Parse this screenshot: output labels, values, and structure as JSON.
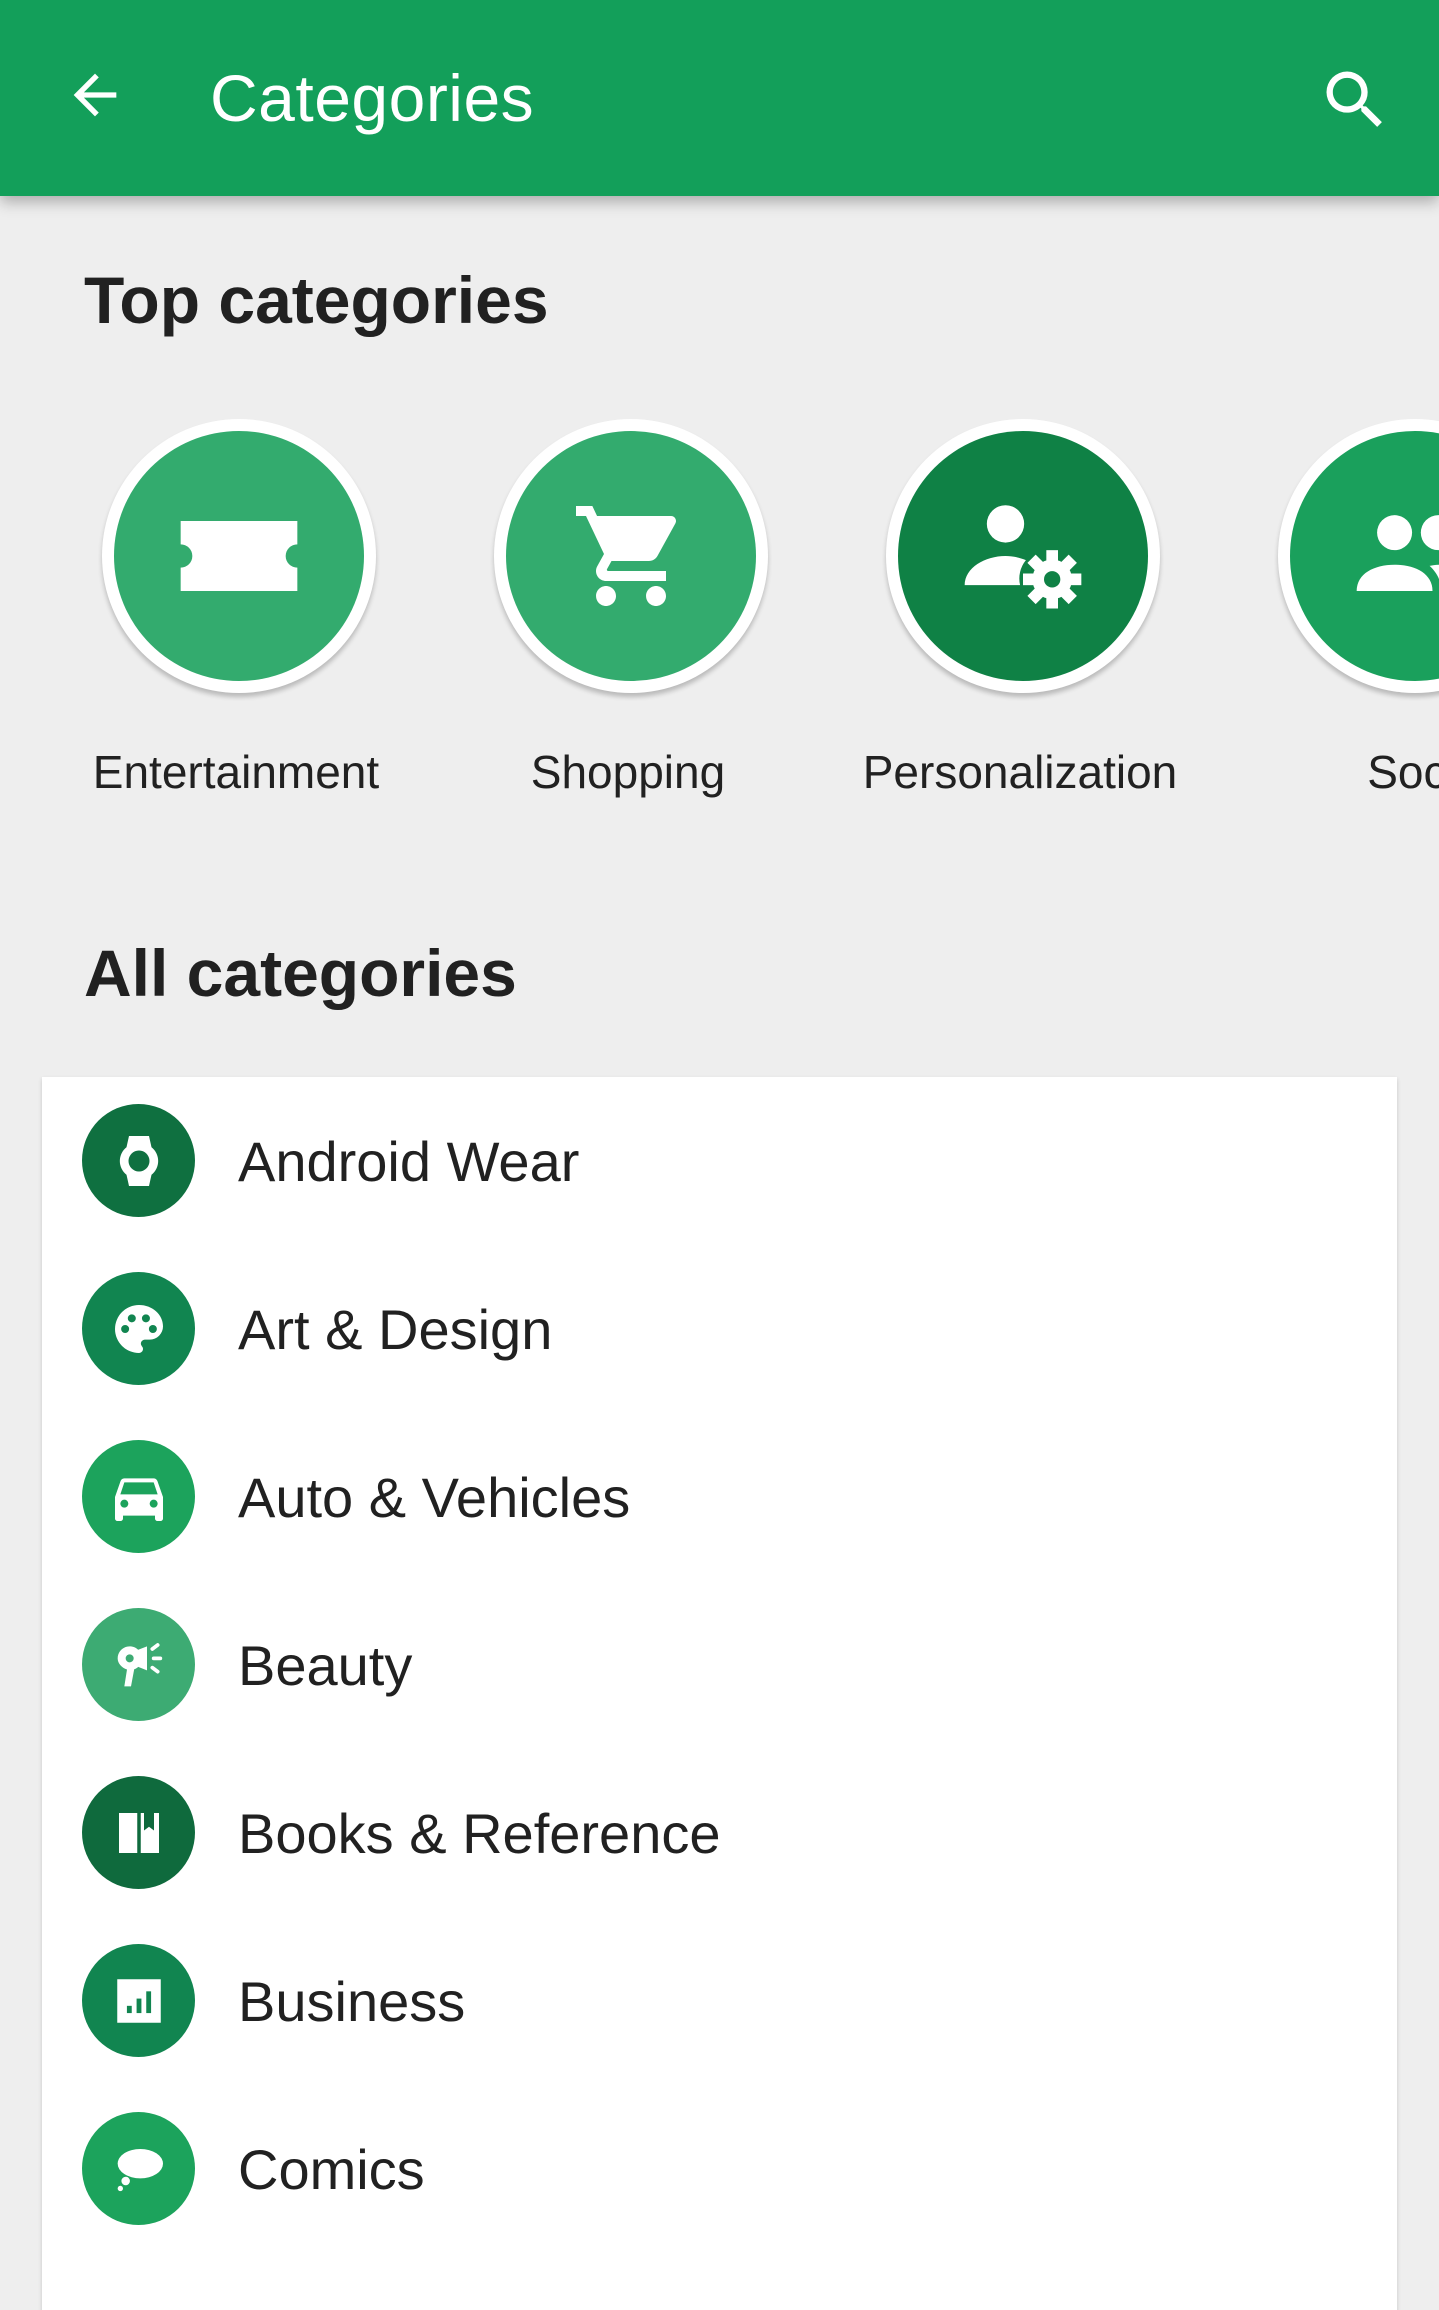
{
  "app_bar": {
    "title": "Categories",
    "back_icon": "arrow-back-icon",
    "search_icon": "search-icon",
    "background_color": "#139f5a"
  },
  "top_categories": {
    "title": "Top categories",
    "items": [
      {
        "label": "Entertainment",
        "icon": "ticket-icon",
        "color": "#33ab6e"
      },
      {
        "label": "Shopping",
        "icon": "shopping-cart-icon",
        "color": "#33ab6e"
      },
      {
        "label": "Personalization",
        "icon": "person-settings-icon",
        "color": "#0f8145"
      },
      {
        "label": "Soci",
        "icon": "people-icon",
        "color": "#1aa05c"
      }
    ]
  },
  "all_categories": {
    "title": "All categories",
    "items": [
      {
        "label": "Android Wear",
        "icon": "watch-icon",
        "color": "#0f7040"
      },
      {
        "label": "Art & Design",
        "icon": "palette-icon",
        "color": "#118550"
      },
      {
        "label": "Auto & Vehicles",
        "icon": "car-icon",
        "color": "#1ca35c"
      },
      {
        "label": "Beauty",
        "icon": "hair-dryer-icon",
        "color": "#3dab73"
      },
      {
        "label": "Books & Reference",
        "icon": "book-icon",
        "color": "#0f6a3d"
      },
      {
        "label": "Business",
        "icon": "chart-icon",
        "color": "#118550"
      },
      {
        "label": "Comics",
        "icon": "speech-bubble-icon",
        "color": "#1ca35c"
      }
    ]
  }
}
